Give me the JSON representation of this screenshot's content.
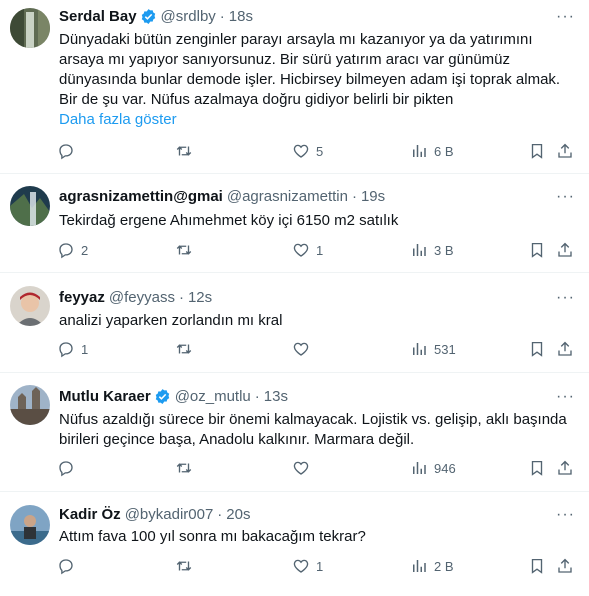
{
  "tweets": [
    {
      "name": "Serdal Bay",
      "verified": true,
      "handle": "@srdlby",
      "time": "18s",
      "text": "Dünyadaki bütün zenginler parayı arsayla mı kazanıyor ya da yatırımını arsaya mı yapıyor sanıyorsunuz. Bir sürü yatırım aracı var günümüz dünyasında bunlar demode işler. Hicbirsey bilmeyen adam işi toprak almak. Bir de şu var. Nüfus azalmaya doğru gidiyor belirli bir pikten",
      "show_more": "Daha fazla göster",
      "replies": "",
      "retweets": "",
      "likes": "5",
      "views": "6 B"
    },
    {
      "name": "agrasnizamettin@gmai",
      "verified": false,
      "handle": "@agrasnizamettin",
      "time": "19s",
      "text": "Tekirdağ ergene Ahımehmet köy içi 6150 m2 satılık",
      "show_more": "",
      "replies": "2",
      "retweets": "",
      "likes": "1",
      "views": "3 B"
    },
    {
      "name": "feyyaz",
      "verified": false,
      "handle": "@feyyass",
      "time": "12s",
      "text": "analizi yaparken zorlandın mı kral",
      "show_more": "",
      "replies": "1",
      "retweets": "",
      "likes": "",
      "views": "531"
    },
    {
      "name": "Mutlu Karaer",
      "verified": true,
      "handle": "@oz_mutlu",
      "time": "13s",
      "text": "Nüfus azaldığı sürece bir önemi kalmayacak. Lojistik vs. gelişip, aklı başında birileri geçince başa, Anadolu kalkınır. Marmara değil.",
      "show_more": "",
      "replies": "",
      "retweets": "",
      "likes": "",
      "views": "946"
    },
    {
      "name": "Kadir Öz",
      "verified": false,
      "handle": "@bykadir007",
      "time": "20s",
      "text": "Attım fava 100 yıl sonra mı bakacağım tekrar?",
      "show_more": "",
      "replies": "",
      "retweets": "",
      "likes": "1",
      "views": "2 B"
    }
  ],
  "dot": "·",
  "more": "···",
  "colors": {
    "link": "#1d9bf0",
    "muted": "#536471",
    "verified": "#1d9bf0"
  }
}
